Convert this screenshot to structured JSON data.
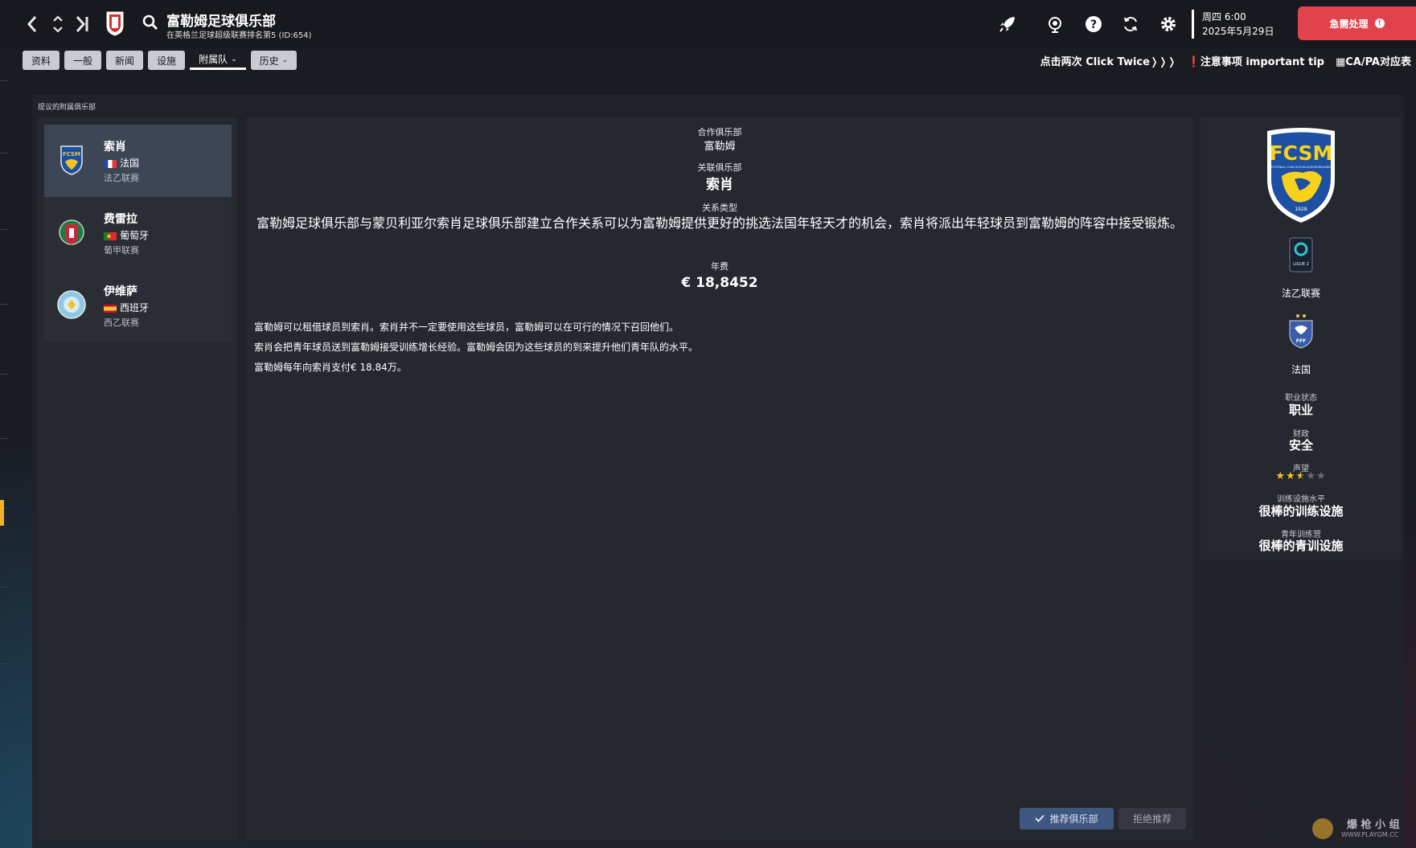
{
  "header": {
    "title": "富勒姆足球俱乐部",
    "subtitle": "在英格兰足球超级联赛排名第5 (ID:654)",
    "date_day": "周四 6:00",
    "date_full": "2025年5月29日",
    "urgent_label": "急需处理",
    "urgent_icon": "!"
  },
  "tabs": [
    {
      "label": "资料"
    },
    {
      "label": "一般"
    },
    {
      "label": "新闻"
    },
    {
      "label": "设施"
    },
    {
      "label": "附属队"
    },
    {
      "label": "历史"
    }
  ],
  "right_links": {
    "click_twice": "点击两次 Click Twice❭❭❭",
    "tip": "❗注意事项 important tip",
    "capa": "▦CA/PA对应表"
  },
  "section_caption": "提议的附属俱乐部",
  "clubs": [
    {
      "name": "索肖",
      "country": "法国",
      "league": "法乙联赛"
    },
    {
      "name": "费雷拉",
      "country": "葡萄牙",
      "league": "葡甲联赛"
    },
    {
      "name": "伊维萨",
      "country": "西班牙",
      "league": "西乙联赛"
    }
  ],
  "detail": {
    "partner_label": "合作俱乐部",
    "partner_value": "富勒姆",
    "affiliate_label": "关联俱乐部",
    "affiliate_value": "索肖",
    "relation_label": "关系类型",
    "relation_text": "富勒姆足球俱乐部与蒙贝利亚尔索肖足球俱乐部建立合作关系可以为富勒姆提供更好的挑选法国年轻天才的机会，索肖将派出年轻球员到富勒姆的阵容中接受锻炼。",
    "fee_label": "年费",
    "fee_value": "€  18,8452",
    "desc": [
      "富勒姆可以租借球员到索肖。索肖并不一定要使用这些球员，富勒姆可以在可行的情况下召回他们。",
      "索肖会把青年球员送到富勒姆接受训练增长经验。富勒姆会因为这些球员的到来提升他们青年队的水平。",
      "富勒姆每年向索肖支付€  18.84万。"
    ],
    "recommend_label": "推荐俱乐部",
    "reject_label": "拒绝推荐"
  },
  "club_info": {
    "crest_text": "FCSM",
    "crest_sub": "FOOTBALL CLUB SOCHAUX-MONTBELIARD",
    "crest_year": "1928",
    "league_logo_text": "LIGUE 2",
    "league": "法乙联赛",
    "nation_logo_text": "FFF",
    "nation": "法国",
    "status_label": "职业状态",
    "status_value": "职业",
    "finance_label": "财政",
    "finance_value": "安全",
    "reputation_label": "声望",
    "reputation_stars": 2.5,
    "training_label": "训练设施水平",
    "training_value": "很棒的训练设施",
    "youth_label": "青年训练营",
    "youth_value": "很棒的青训设施"
  },
  "watermark": {
    "text": "爆 枪 小 组",
    "url": "WWW.PLAYGM.CC"
  },
  "colors": {
    "urgent": "#e0434b",
    "accent_rail": "#f1b12d",
    "selected_card": "#3c4654",
    "recommend_btn": "#3f5680",
    "star": "#f3c41f"
  }
}
